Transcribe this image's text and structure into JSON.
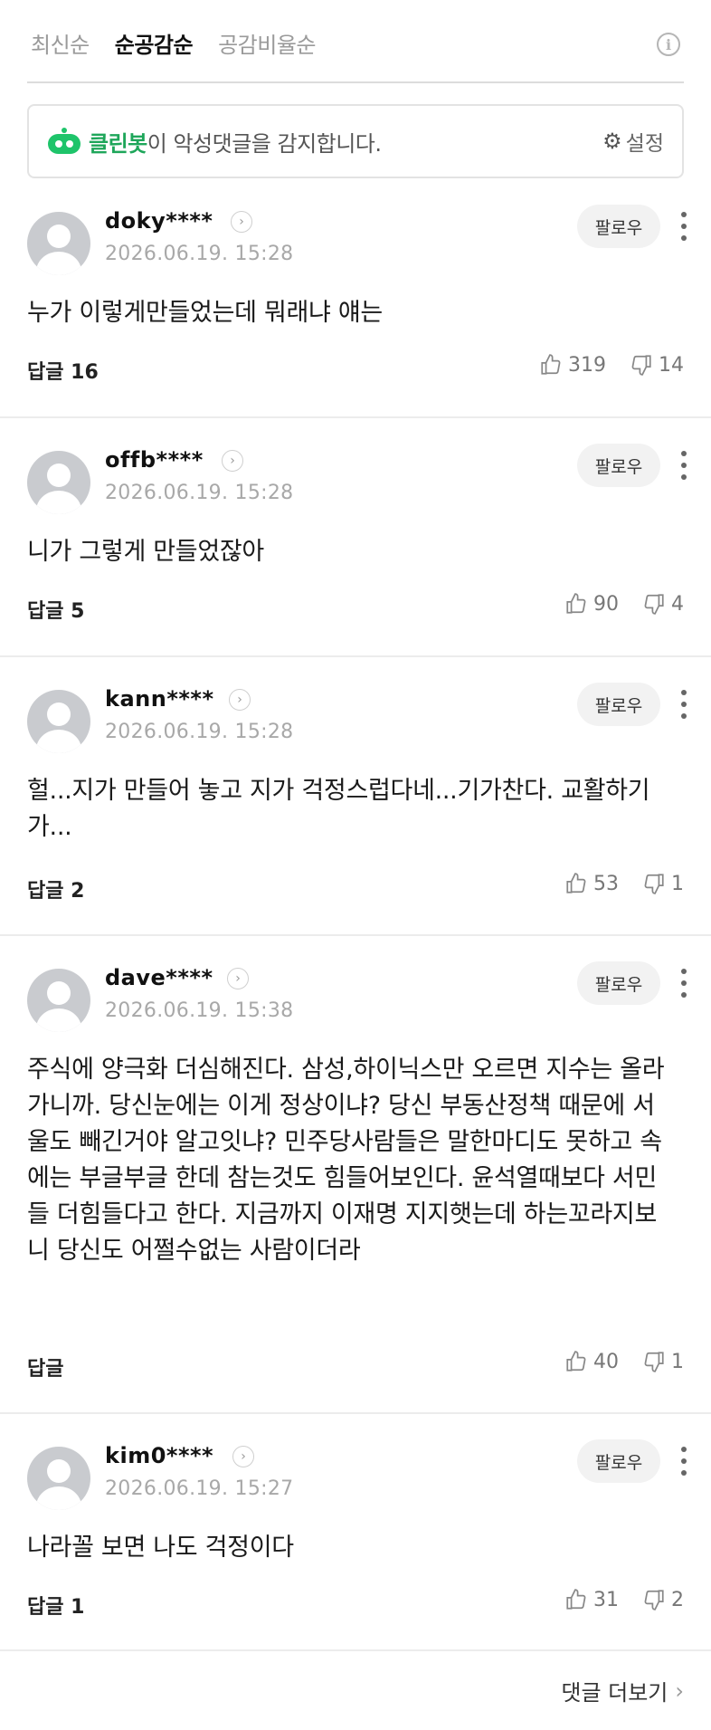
{
  "sort": {
    "tabs": [
      {
        "label": "최신순"
      },
      {
        "label": "순공감순"
      },
      {
        "label": "공감비율순"
      }
    ],
    "active_index": 1,
    "info_icon": "info-icon"
  },
  "cleanbot": {
    "name": "클린봇",
    "message": "이 악성댓글을 감지합니다.",
    "settings_label": "설정",
    "accent_color": "#1ec46a"
  },
  "comments": [
    {
      "username": "doky****",
      "timestamp": "2026.06.19. 15:28",
      "follow_label": "팔로우",
      "text": "누가 이렇게만들었는데 뭐래냐 얘는",
      "reply_label": "답글 16",
      "likes": "319",
      "dislikes": "14"
    },
    {
      "username": "offb****",
      "timestamp": "2026.06.19. 15:28",
      "follow_label": "팔로우",
      "text": "니가 그렇게 만들었잖아",
      "reply_label": "답글 5",
      "likes": "90",
      "dislikes": "4"
    },
    {
      "username": "kann****",
      "timestamp": "2026.06.19. 15:28",
      "follow_label": "팔로우",
      "text": "헐...지가 만들어 놓고 지가 걱정스럽다네...기가찬다. 교활하기가...",
      "reply_label": "답글 2",
      "likes": "53",
      "dislikes": "1"
    },
    {
      "username": "dave****",
      "timestamp": "2026.06.19. 15:38",
      "follow_label": "팔로우",
      "text": "주식에 양극화 더심해진다. 삼성,하이닉스만 오르면 지수는 올라가니까. 당신눈에는 이게 정상이냐? 당신 부동산정책 때문에 서울도 빼긴거야 알고잇냐? 민주당사람들은 말한마디도 못하고 속에는 부글부글 한데 참는것도 힘들어보인다. 윤석열때보다 서민들 더힘들다고 한다. 지금까지 이재명 지지햇는데 하는꼬라지보니 당신도 어쩔수없는 사람이더라",
      "reply_label": "답글",
      "likes": "40",
      "dislikes": "1"
    },
    {
      "username": "kim0****",
      "timestamp": "2026.06.19. 15:27",
      "follow_label": "팔로우",
      "text": "나라꼴 보면 나도 걱정이다",
      "reply_label": "답글 1",
      "likes": "31",
      "dislikes": "2"
    }
  ],
  "footer": {
    "more_label": "댓글 더보기"
  }
}
